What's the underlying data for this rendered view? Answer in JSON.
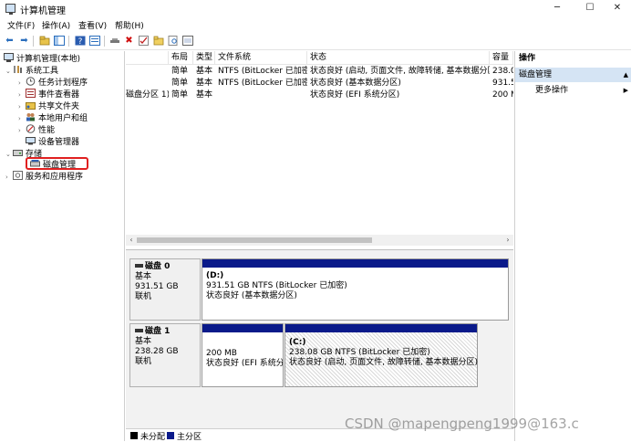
{
  "window": {
    "title": "计算机管理",
    "minimize": "─",
    "maximize": "☐",
    "close": "✕"
  },
  "menu": [
    "文件(F)",
    "操作(A)",
    "查看(V)",
    "帮助(H)"
  ],
  "tree": {
    "root": "计算机管理(本地)",
    "system_tools": "系统工具",
    "task_scheduler": "任务计划程序",
    "event_viewer": "事件查看器",
    "shared_folders": "共享文件夹",
    "local_users": "本地用户和组",
    "performance": "性能",
    "device_manager": "设备管理器",
    "storage": "存储",
    "disk_management": "磁盘管理",
    "services": "服务和应用程序"
  },
  "volume_list": {
    "columns": [
      "",
      "布局",
      "类型",
      "文件系统",
      "状态",
      "容量"
    ],
    "rows": [
      [
        "",
        "简单",
        "基本",
        "NTFS (BitLocker 已加密)",
        "状态良好 (启动, 页面文件, 故障转储, 基本数据分区)",
        "238.0"
      ],
      [
        "",
        "简单",
        "基本",
        "NTFS (BitLocker 已加密)",
        "状态良好 (基本数据分区)",
        "931.5"
      ],
      [
        "磁盘分区 1)",
        "简单",
        "基本",
        "",
        "状态良好 (EFI 系统分区)",
        "200 M"
      ]
    ]
  },
  "disks": [
    {
      "name": "磁盘 0",
      "type": "基本",
      "size": "931.51 GB",
      "status": "联机",
      "partitions": [
        {
          "label": "(D:)",
          "detail": "931.51 GB NTFS (BitLocker 已加密)",
          "status": "状态良好 (基本数据分区)"
        }
      ]
    },
    {
      "name": "磁盘 1",
      "type": "基本",
      "size": "238.28 GB",
      "status": "联机",
      "partitions": [
        {
          "label": "",
          "detail": "200 MB",
          "status": "状态良好 (EFI 系统分["
        },
        {
          "label": "(C:)",
          "detail": "238.08 GB NTFS (BitLocker 已加密)",
          "status": "状态良好 (启动, 页面文件, 故障转储, 基本数据分区)"
        }
      ]
    }
  ],
  "legend": {
    "unallocated": "未分配",
    "primary": "主分区",
    "unallocated_color": "#000000",
    "primary_color": "#0a1a8a"
  },
  "actions": {
    "title": "操作",
    "section": "磁盘管理",
    "more": "更多操作"
  },
  "watermark": "CSDN @mapengpeng1999@163.c"
}
